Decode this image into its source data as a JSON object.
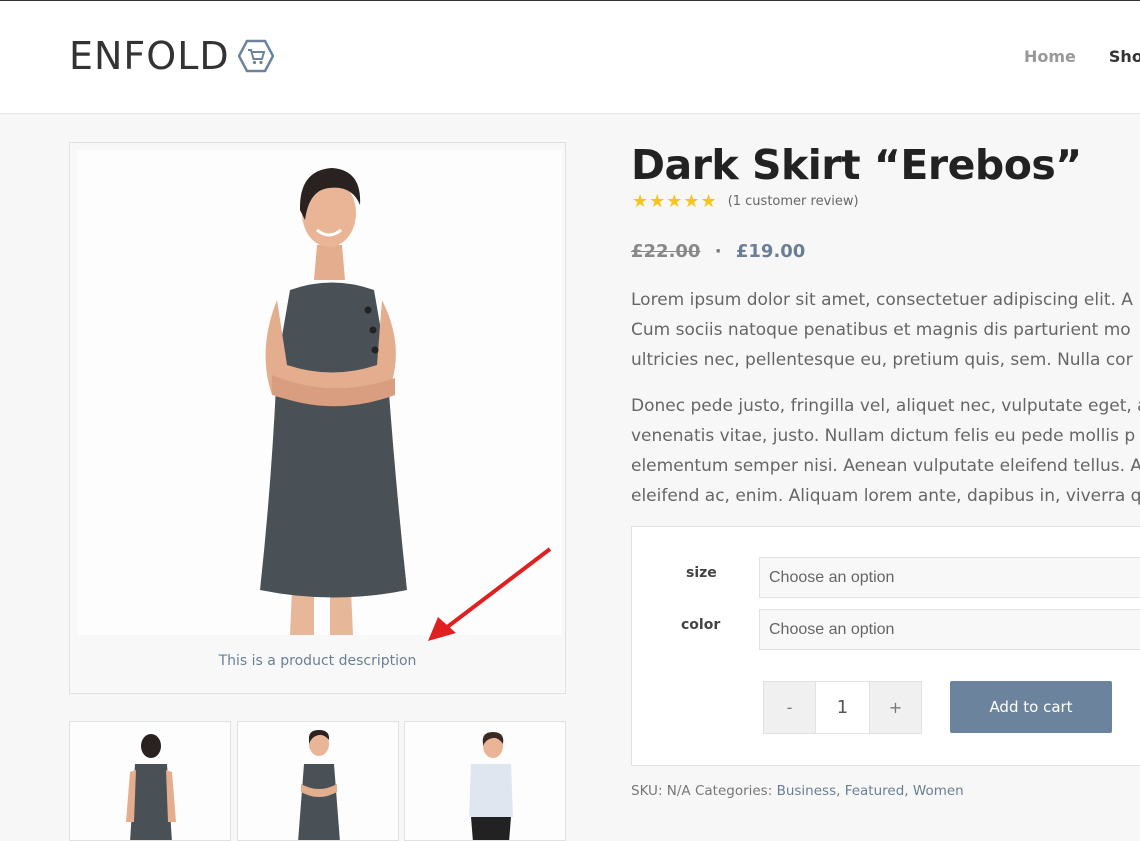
{
  "header": {
    "logo_text": "ENFOLD",
    "nav": {
      "home": "Home",
      "shop": "Shop"
    }
  },
  "gallery": {
    "caption": "This is a product description"
  },
  "product": {
    "title": "Dark Skirt “Erebos”",
    "stars": "★★★★★",
    "rating": 5,
    "review_link": "(1 customer review)",
    "old_price": "£22.00",
    "separator": "·",
    "new_price": "£19.00",
    "description": [
      {
        "line1": "Lorem ipsum dolor sit amet, consectetuer adipiscing elit. A",
        "line2": "Cum sociis natoque penatibus et magnis dis parturient mo",
        "line3": "ultricies nec, pellentesque eu, pretium quis, sem. Nulla cor"
      },
      {
        "line1": "Donec pede justo, fringilla vel, aliquet nec, vulputate eget, a",
        "line2": "venenatis vitae, justo. Nullam dictum felis eu pede mollis p",
        "line3": "elementum semper nisi. Aenean vulputate eleifend tellus. A",
        "line4": "eleifend ac, enim. Aliquam lorem ante, dapibus in, viverra q"
      }
    ]
  },
  "cart": {
    "size_label": "size",
    "size_value": "Choose an option",
    "color_label": "color",
    "color_value": "Choose an option",
    "minus": "-",
    "quantity": "1",
    "plus": "+",
    "add_to_cart": "Add to cart"
  },
  "meta": {
    "sku_text": "SKU: N/A Categories:",
    "categories": [
      "Business",
      "Featured",
      "Women"
    ],
    "comma": ","
  },
  "colors": {
    "accent": "#6b839c",
    "star": "#f5c518",
    "arrow": "#e02020"
  }
}
